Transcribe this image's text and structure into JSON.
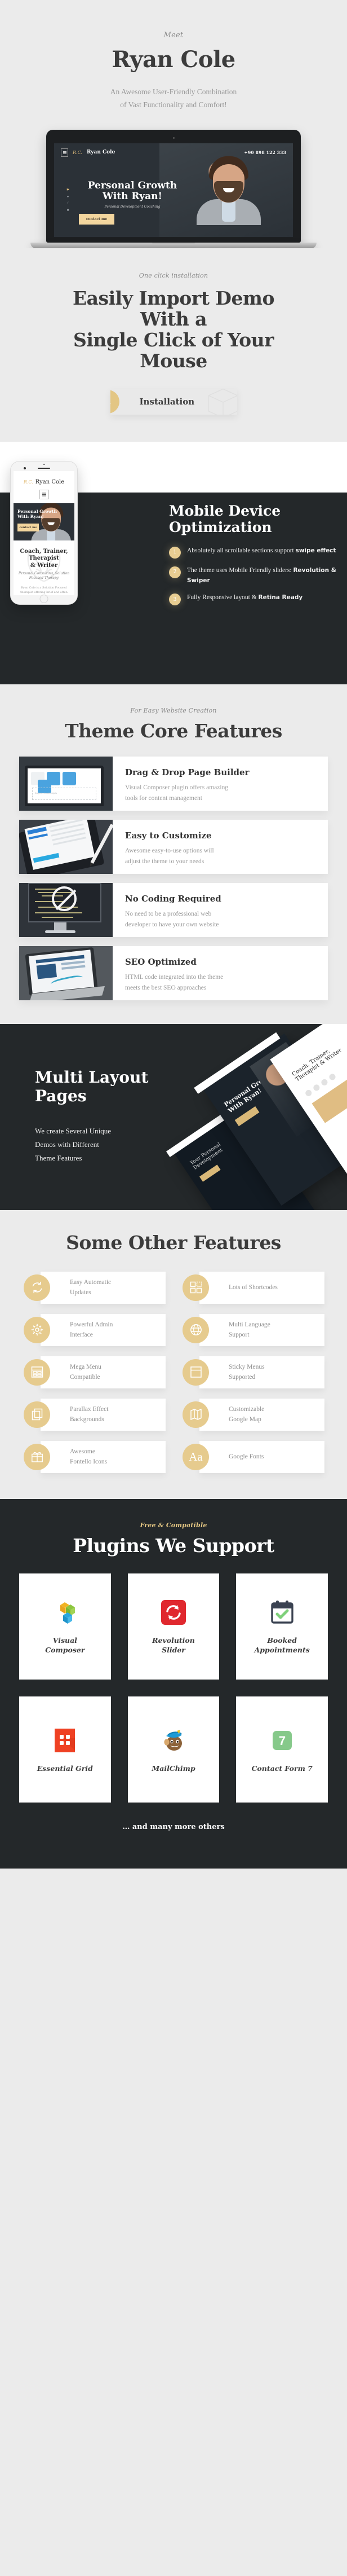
{
  "hero": {
    "eyebrow": "Meet",
    "name": "Ryan Cole",
    "tagline_line1": "An Awesome User-Friendly Combination",
    "tagline_line2": "of Vast Functionality and Comfort!",
    "mockup": {
      "logo_name": "Ryan Cole",
      "phone": "+90 898 122 333",
      "heading_line1": "Personal Growth",
      "heading_line2": "With Ryan!",
      "subheading": "Personal Development Coaching",
      "button": "contact me"
    }
  },
  "install": {
    "eyebrow": "One click installation",
    "heading_line1": "Easily Import Demo With a",
    "heading_line2": "Single Click of Your Mouse",
    "button_label": "Installation"
  },
  "mobile": {
    "heading_line1": "Mobile Device",
    "heading_line2": "Optimization",
    "items": [
      {
        "num": "1",
        "text": "Absolutely all scrollable sections support ",
        "bold": "swipe effect"
      },
      {
        "num": "2",
        "text": "The theme uses Mobile Friendly sliders: ",
        "bold": "Revolution & Swiper"
      },
      {
        "num": "3",
        "text": "Fully Responsive layout & ",
        "bold": "Retina Ready"
      }
    ],
    "phone_mockup": {
      "logo_name": "Ryan Cole",
      "hero_line1": "Personal Growth",
      "hero_line2": "With Ryan!",
      "button": "contact me",
      "title_line1": "Coach, Trainer,",
      "title_line2": "Therapist",
      "title_line3": "& Writer",
      "subtitle": "Personal Consulting, Solution Focused Therapy",
      "body": "Ryan Cole is a Solution Focused therapist offering brief and often single-session therapy. He have built a reputation for engaging workshops on Solution Focused Brief Therapy and Single Session Therapy, and have recently started to put my courses online."
    }
  },
  "core": {
    "eyebrow": "For Easy Website Creation",
    "heading": "Theme Core Features",
    "features": [
      {
        "title": "Drag & Drop Page Builder",
        "desc_line1": "Visual Composer plugin offers amazing",
        "desc_line2": "tools for content management",
        "thumb": "page-builder-thumb"
      },
      {
        "title": "Easy to Customize",
        "desc_line1": "Awesome easy-to-use options will",
        "desc_line2": "adjust the theme to your needs",
        "thumb": "tablet-stylus-thumb"
      },
      {
        "title": "No Coding Required",
        "desc_line1": "No need to be a professional web",
        "desc_line2": "developer to have your own website",
        "thumb": "no-code-thumb"
      },
      {
        "title": "SEO Optimized",
        "desc_line1": "HTML code integrated into the theme",
        "desc_line2": "meets the best SEO approaches",
        "thumb": "seo-thumb"
      }
    ]
  },
  "multi": {
    "heading_line1": "Multi Layout",
    "heading_line2": "Pages",
    "desc_line1": "We create Several Unique",
    "desc_line2": "Demos with Different",
    "desc_line3": "Theme Features"
  },
  "other": {
    "heading": "Some Other Features",
    "features": [
      {
        "label_line1": "Easy Automatic",
        "label_line2": "Updates",
        "icon": "refresh-icon"
      },
      {
        "label_line1": "Lots of Shortcodes",
        "label_line2": "",
        "icon": "grid-blocks-icon"
      },
      {
        "label_line1": "Powerful Admin",
        "label_line2": "Interface",
        "icon": "gear-icon"
      },
      {
        "label_line1": "Multi Language",
        "label_line2": "Support",
        "icon": "globe-icon"
      },
      {
        "label_line1": "Mega Menu",
        "label_line2": "Compatible",
        "icon": "mega-menu-icon"
      },
      {
        "label_line1": "Sticky Menus",
        "label_line2": "Supported",
        "icon": "sticky-menu-icon"
      },
      {
        "label_line1": "Parallax Effect",
        "label_line2": "Backgrounds",
        "icon": "layers-icon"
      },
      {
        "label_line1": "Customizable",
        "label_line2": "Google Map",
        "icon": "map-icon"
      },
      {
        "label_line1": "Awesome",
        "label_line2": "Fontello Icons",
        "icon": "gift-icon"
      },
      {
        "label_line1": "Google Fonts",
        "label_line2": "",
        "icon": "typography-aa-icon"
      }
    ]
  },
  "plugins": {
    "eyebrow": "Free & Compatible",
    "heading": "Plugins We Support",
    "items": [
      {
        "name_line1": "Visual",
        "name_line2": "Composer",
        "icon": "visual-composer-logo"
      },
      {
        "name_line1": "Revolution",
        "name_line2": "Slider",
        "icon": "revolution-slider-logo"
      },
      {
        "name_line1": "Booked",
        "name_line2": "Appointments",
        "icon": "booked-appointments-logo"
      },
      {
        "name_line1": "Essential Grid",
        "name_line2": "",
        "icon": "essential-grid-logo"
      },
      {
        "name_line1": "MailChimp",
        "name_line2": "",
        "icon": "mailchimp-logo"
      },
      {
        "name_line1": "Contact Form 7",
        "name_line2": "",
        "icon": "contact-form-7-logo"
      }
    ],
    "footer_note": "… and many more others"
  },
  "colors": {
    "accent_gold": "#e3c684",
    "dark": "#24282a",
    "light_bg": "#ebebeb",
    "text_dark": "#3c3c3c",
    "text_muted": "#9b9b9b"
  }
}
